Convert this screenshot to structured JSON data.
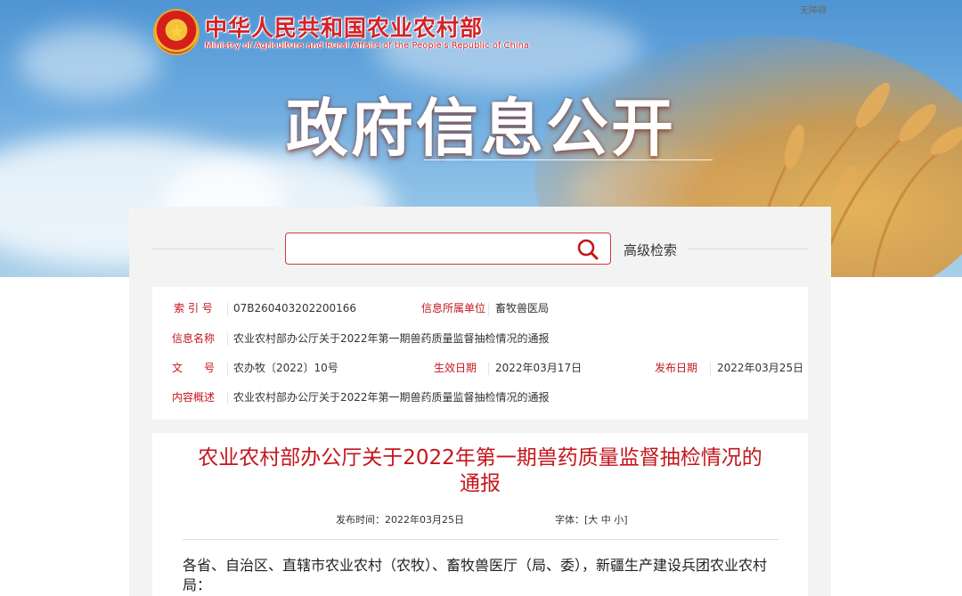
{
  "header": {
    "site_title_cn": "中华人民共和国农业农村部",
    "site_title_en": "Ministry of Agriculture and Rural Affairs of the People's Republic of China",
    "accessibility_link": "无障碍",
    "hero_title": "政府信息公开",
    "emblem_icon": "national-emblem"
  },
  "search": {
    "placeholder": "",
    "advanced_label": "高级检索"
  },
  "meta": {
    "index_label": "索 引 号",
    "index_value": "07B260403202200166",
    "unit_label": "信息所属单位",
    "unit_value": "畜牧兽医局",
    "name_label": "信息名称",
    "name_value": "农业农村部办公厅关于2022年第一期兽药质量监督抽检情况的通报",
    "docno_label": "文　　号",
    "docno_value": "农办牧〔2022〕10号",
    "effective_label": "生效日期",
    "effective_value": "2022年03月17日",
    "release_label": "发布日期",
    "release_value": "2022年03月25日",
    "summary_label": "内容概述",
    "summary_value": "农业农村部办公厅关于2022年第一期兽药质量监督抽检情况的通报"
  },
  "article": {
    "title": "农业农村部办公厅关于2022年第一期兽药质量监督抽检情况的通报",
    "publish_label": "发布时间：",
    "publish_value": "2022年03月25日",
    "font_label": "字体：[",
    "font_large": "大",
    "font_medium": "中",
    "font_small": "小",
    "font_close": "]",
    "paragraph": "各省、自治区、直辖市农业农村（农牧）、畜牧兽医厅（局、委），新疆生产建设兵团农业农村局："
  },
  "colors": {
    "accent_red": "#c3161c",
    "sky_blue": "#5b9fd8",
    "wheat_gold": "#e0a545"
  }
}
